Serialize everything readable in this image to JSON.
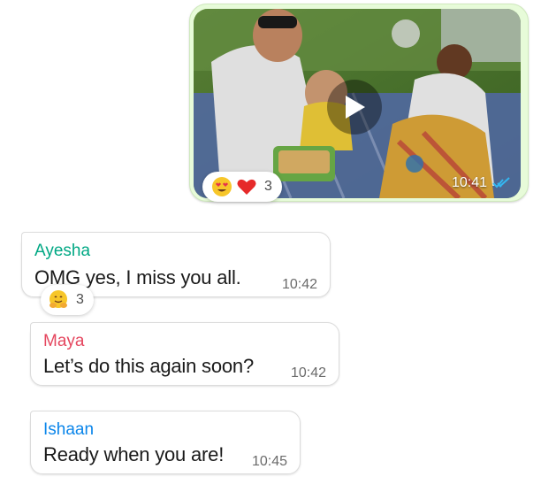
{
  "video_message": {
    "time": "10:41",
    "status_icon": "double-check-icon",
    "status_color": "#34b7f1",
    "reactions": {
      "emojis": [
        "heart-eyes-emoji",
        "red-heart-emoji"
      ],
      "count": "3"
    }
  },
  "messages": [
    {
      "sender": "Ayesha",
      "sender_color": "#00a884",
      "text": "OMG yes, I miss you all.",
      "time": "10:42",
      "reactions": {
        "emojis": [
          "hugging-face-emoji"
        ],
        "count": "3"
      }
    },
    {
      "sender": "Maya",
      "sender_color": "#e5475f",
      "text": "Let’s do this again soon?",
      "time": "10:42"
    },
    {
      "sender": "Ishaan",
      "sender_color": "#0a85ea",
      "text": "Ready when you are!",
      "time": "10:45"
    }
  ],
  "colors": {
    "outgoing_bubble": "#e7fbd9",
    "incoming_bubble": "#ffffff",
    "time_text": "#6b6b6b"
  }
}
